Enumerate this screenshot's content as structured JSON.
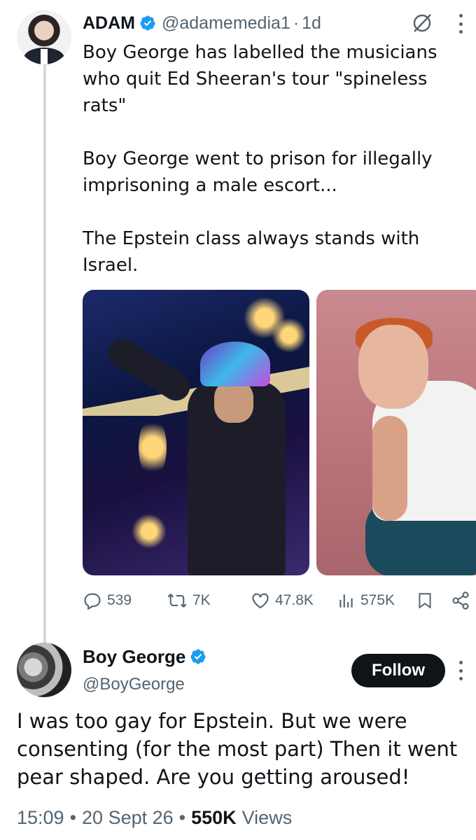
{
  "original_post": {
    "author_name": "ADAM",
    "author_handle": "@adamemedia1",
    "separator": "·",
    "relative_time": "1d",
    "paragraphs": [
      "Boy George has labelled the musicians who quit Ed Sheeran's tour \"spineless rats\"",
      "Boy George went to prison for illegally imprisoning a male escort...",
      "The Epstein class always stands with Israel."
    ],
    "stats": {
      "replies": "539",
      "reposts": "7K",
      "likes": "47.8K",
      "views": "575K"
    }
  },
  "reply_post": {
    "author_name": "Boy George",
    "author_handle": "@BoyGeorge",
    "follow_label": "Follow",
    "text": "I was too gay for Epstein. But we were consenting (for the most part) Then it went pear shaped. Are you getting aroused!",
    "time": "15:09",
    "date": "20 Sept 26",
    "views_count": "550K",
    "views_label": "Views",
    "dot": "•"
  },
  "colors": {
    "text_primary": "#0f1419",
    "text_secondary": "#536471",
    "verified_blue": "#1d9bf0",
    "thread_line": "#cfd9de",
    "follow_bg": "#0f1419"
  },
  "icons": [
    "verified-badge-icon",
    "grok-icon",
    "more-icon",
    "reply-icon",
    "repost-icon",
    "like-icon",
    "views-icon",
    "bookmark-icon",
    "share-icon"
  ]
}
